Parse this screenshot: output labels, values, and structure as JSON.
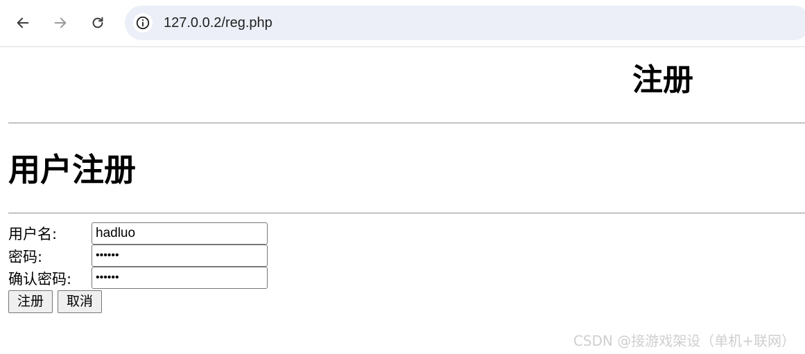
{
  "browser": {
    "back_icon": "arrow-left-icon",
    "forward_icon": "arrow-right-icon",
    "reload_icon": "reload-icon",
    "site_info_icon": "info-icon",
    "url": "127.0.0.2/reg.php"
  },
  "page": {
    "site_title": "注册",
    "heading": "用户注册"
  },
  "form": {
    "username_label": "用户名:",
    "username_value": "hadluo",
    "password_label": "密码:",
    "password_value": "123456",
    "confirm_label": "确认密码:",
    "confirm_value": "123456",
    "submit_label": "注册",
    "cancel_label": "取消"
  },
  "watermark": "CSDN @接游戏架设（单机+联网）",
  "colors": {
    "omnibox_bg": "#eceff7",
    "rule": "#8c8c8c",
    "watermark": "#cfcfcf"
  }
}
